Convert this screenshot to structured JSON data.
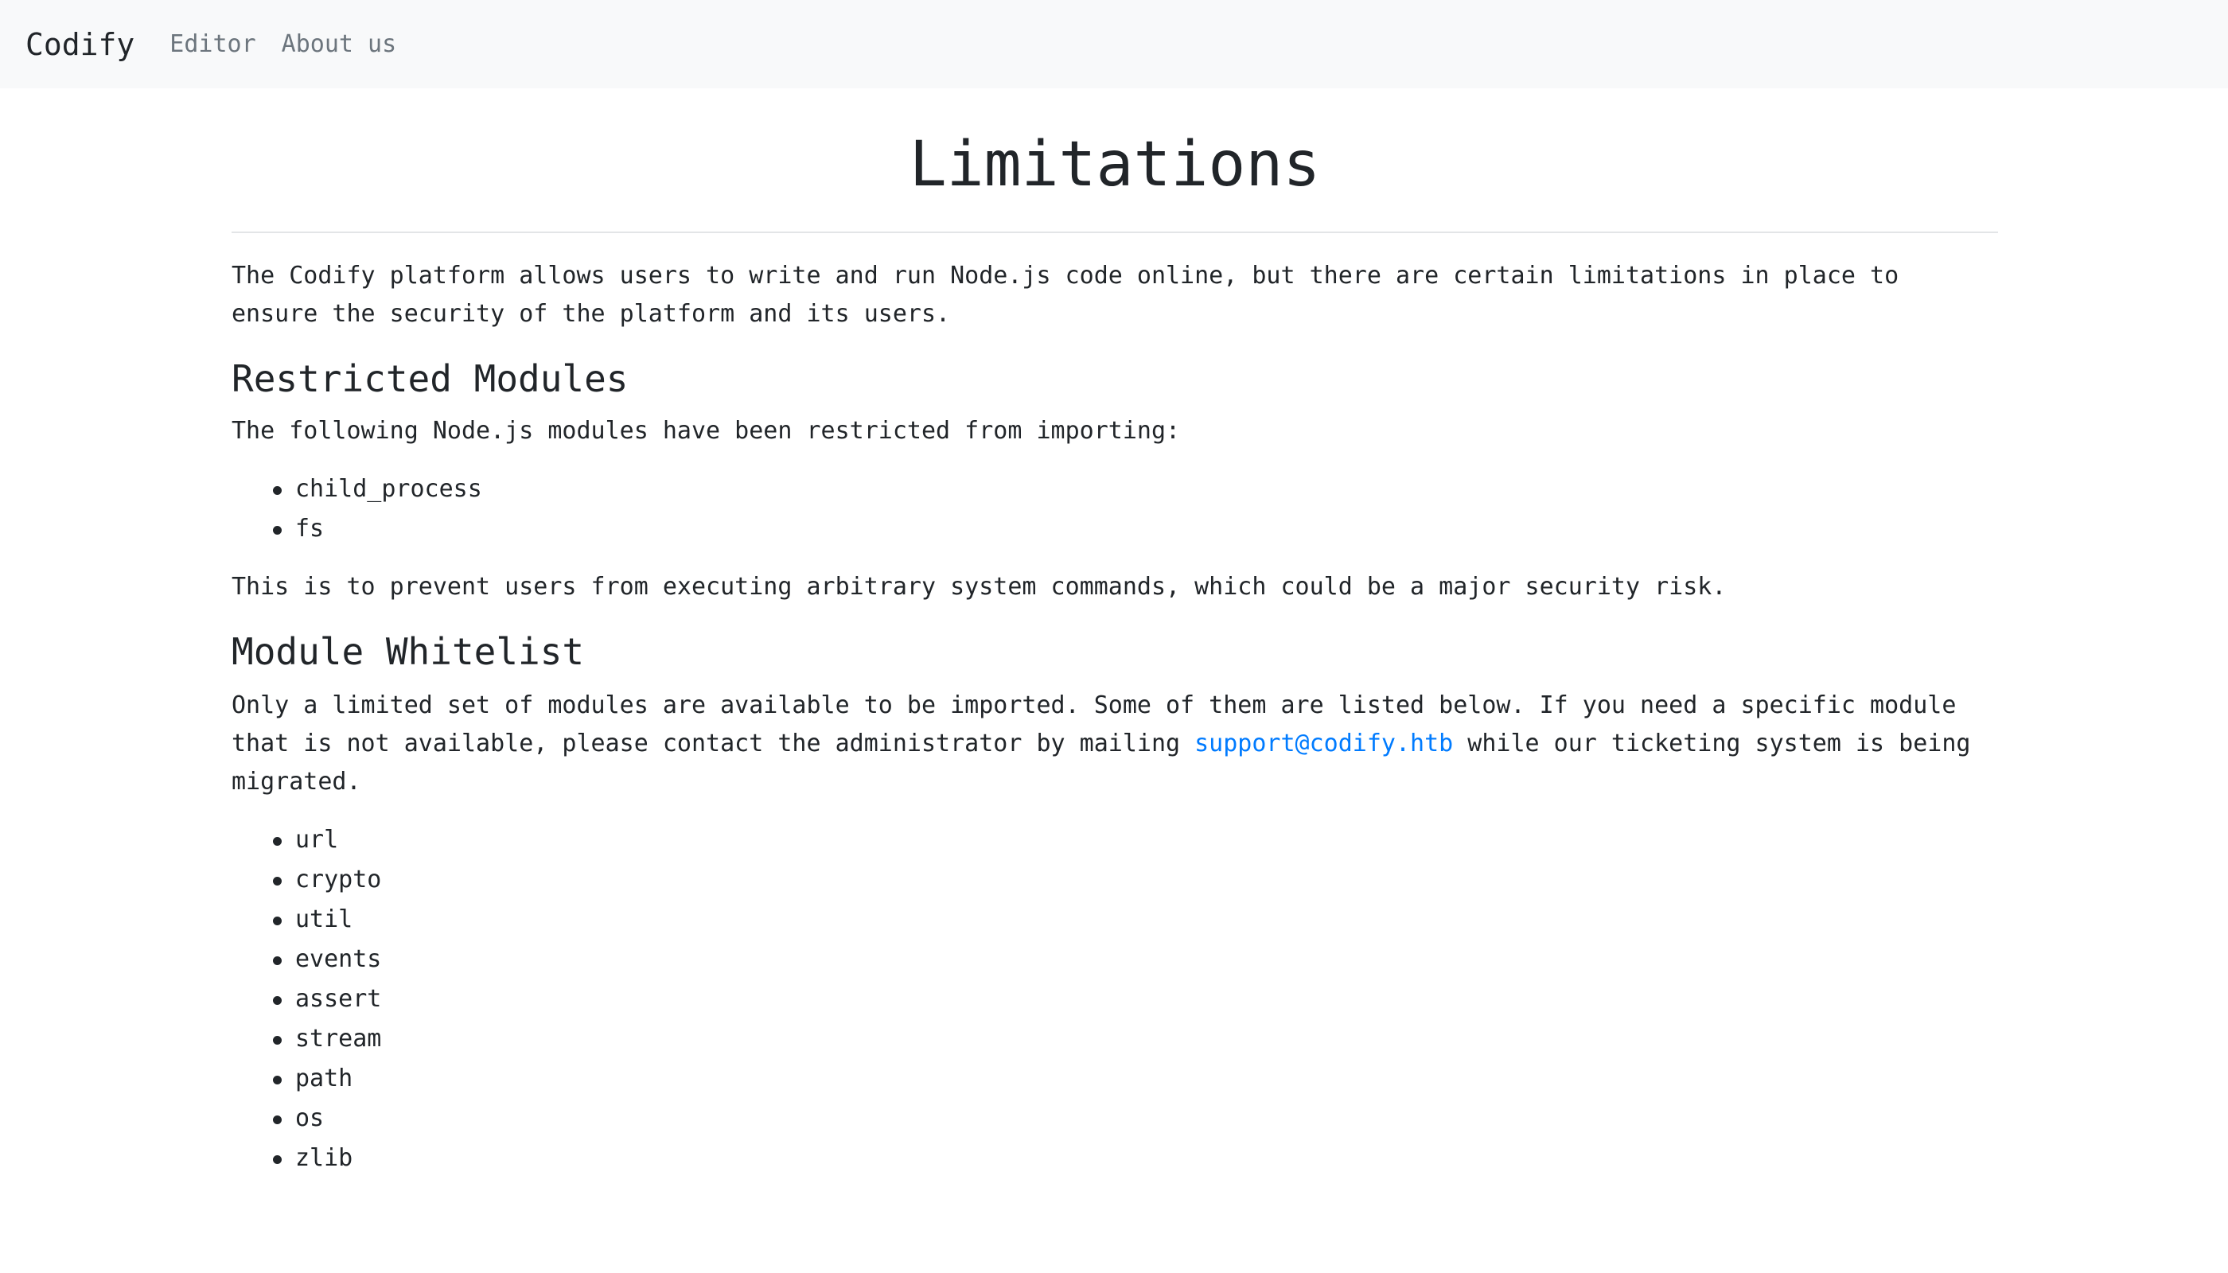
{
  "navbar": {
    "brand": "Codify",
    "links": [
      "Editor",
      "About us"
    ]
  },
  "page": {
    "title": "Limitations",
    "intro": "The Codify platform allows users to write and run Node.js code online, but there are certain limitations in place to ensure the security of the platform and its users."
  },
  "restricted": {
    "heading": "Restricted Modules",
    "description": "The following Node.js modules have been restricted from importing:",
    "modules": [
      "child_process",
      "fs"
    ],
    "note": "This is to prevent users from executing arbitrary system commands, which could be a major security risk."
  },
  "whitelist": {
    "heading": "Module Whitelist",
    "description_before": "Only a limited set of modules are available to be imported. Some of them are listed below. If you need a specific module that is not available, please contact the administrator by mailing ",
    "email": "support@codify.htb",
    "description_after": " while our ticketing system is being migrated.",
    "modules": [
      "url",
      "crypto",
      "util",
      "events",
      "assert",
      "stream",
      "path",
      "os",
      "zlib"
    ]
  },
  "colors": {
    "link": "#007bff",
    "navbar_bg": "#f8f9fa",
    "nav_link": "#6c757d",
    "text": "#212529"
  }
}
